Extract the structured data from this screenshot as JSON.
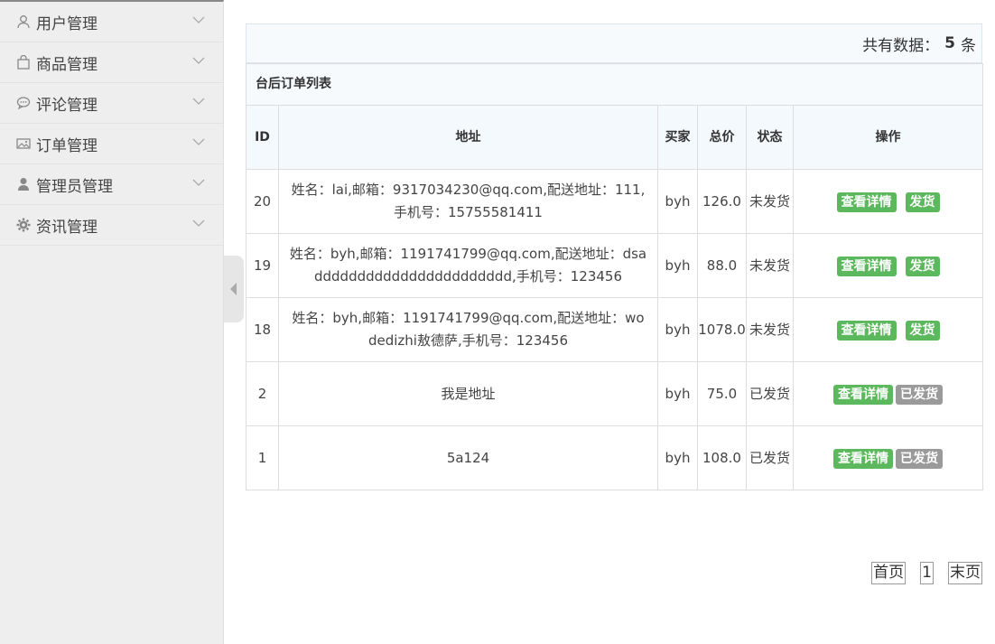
{
  "sidebar": {
    "items": [
      {
        "label": "用户管理",
        "icon": "user-outline-icon"
      },
      {
        "label": "商品管理",
        "icon": "shopping-bag-icon"
      },
      {
        "label": "评论管理",
        "icon": "comment-icon"
      },
      {
        "label": "订单管理",
        "icon": "image-icon"
      },
      {
        "label": "管理员管理",
        "icon": "user-solid-icon"
      },
      {
        "label": "资讯管理",
        "icon": "gear-icon"
      }
    ]
  },
  "summary": {
    "prefix": "共有数据：",
    "count": "5",
    "suffix": "条"
  },
  "table": {
    "caption": "台后订单列表",
    "headers": [
      "ID",
      "地址",
      "买家",
      "总价",
      "状态",
      "操作"
    ],
    "rows": [
      {
        "id": "20",
        "address": "姓名：lai,邮箱：9317034230@qq.com,配送地址：111,手机号：15755581411",
        "buyer": "byh",
        "total": "126.0",
        "status": "未发货",
        "detail_btn": "查看详情",
        "ship_btn": "发货",
        "shipped": false
      },
      {
        "id": "19",
        "address": "姓名：byh,邮箱：1191741799@qq.com,配送地址：dsaddddddddddddddddddddddd,手机号：123456",
        "buyer": "byh",
        "total": "88.0",
        "status": "未发货",
        "detail_btn": "查看详情",
        "ship_btn": "发货",
        "shipped": false
      },
      {
        "id": "18",
        "address": "姓名：byh,邮箱：1191741799@qq.com,配送地址：wodedizhi敖德萨,手机号：123456",
        "buyer": "byh",
        "total": "1078.0",
        "status": "未发货",
        "detail_btn": "查看详情",
        "ship_btn": "发货",
        "shipped": false
      },
      {
        "id": "2",
        "address": "我是地址",
        "buyer": "byh",
        "total": "75.0",
        "status": "已发货",
        "detail_btn": "查看详情",
        "ship_btn": "已发货",
        "shipped": true
      },
      {
        "id": "1",
        "address": "5a124",
        "buyer": "byh",
        "total": "108.0",
        "status": "已发货",
        "detail_btn": "查看详情",
        "ship_btn": "已发货",
        "shipped": true
      }
    ]
  },
  "pager": {
    "first": "首页",
    "current": "1",
    "last": "末页"
  },
  "colors": {
    "green": "#5cb85c",
    "gray": "#9a9a9a"
  }
}
